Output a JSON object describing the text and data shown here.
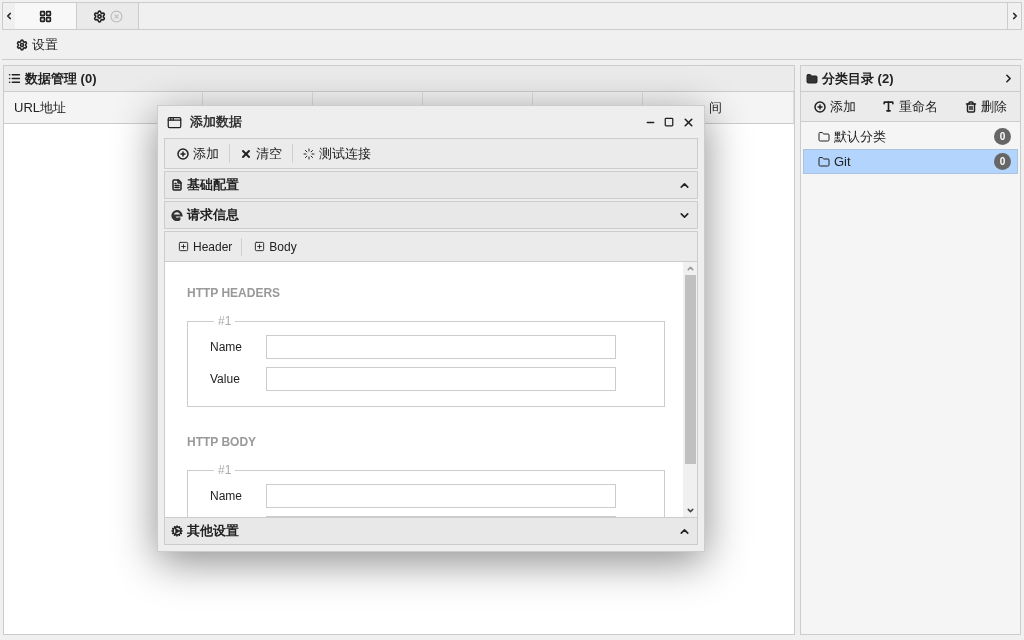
{
  "tabs": [
    {
      "kind": "grid",
      "selected": true
    },
    {
      "kind": "gear",
      "selected": false
    }
  ],
  "toolbar": {
    "label": "设置"
  },
  "data_panel": {
    "title": "数据管理 (0)",
    "columns": [
      {
        "label": "URL地址"
      },
      {},
      {},
      {},
      {},
      {
        "label": "间"
      }
    ]
  },
  "category_panel": {
    "title": "分类目录 (2)",
    "actions": [
      {
        "kind": "plus",
        "label": "添加"
      },
      {
        "kind": "font",
        "label": "重命名"
      },
      {
        "kind": "trash",
        "label": "删除"
      }
    ],
    "items": [
      {
        "label": "默认分类",
        "count": "0",
        "selected": false
      },
      {
        "label": "Git",
        "count": "0",
        "selected": true
      }
    ]
  },
  "dialog": {
    "title": "添加数据",
    "actions": [
      {
        "kind": "plus",
        "label": "添加"
      },
      {
        "kind": "x",
        "label": "清空"
      },
      {
        "kind": "spinner",
        "label": "测试连接"
      }
    ],
    "sections": [
      {
        "kind": "file",
        "title": "基础配置",
        "expanded": false
      },
      {
        "kind": "ie",
        "title": "请求信息",
        "expanded": true
      }
    ],
    "subtabs": [
      {
        "label": "Header"
      },
      {
        "label": "Body"
      }
    ],
    "groups": [
      {
        "title": "HTTP HEADERS",
        "legend": "#1",
        "fields": [
          {
            "kind": "labeled",
            "label": "Name"
          },
          {
            "kind": "labeled",
            "label": "Value"
          }
        ]
      },
      {
        "title": "HTTP BODY",
        "legend": "#1",
        "fields": [
          {
            "kind": "labeled",
            "label": "Name"
          },
          {
            "kind": "cut"
          }
        ]
      }
    ],
    "footer_section": {
      "title": "其他设置",
      "expanded": false
    }
  }
}
